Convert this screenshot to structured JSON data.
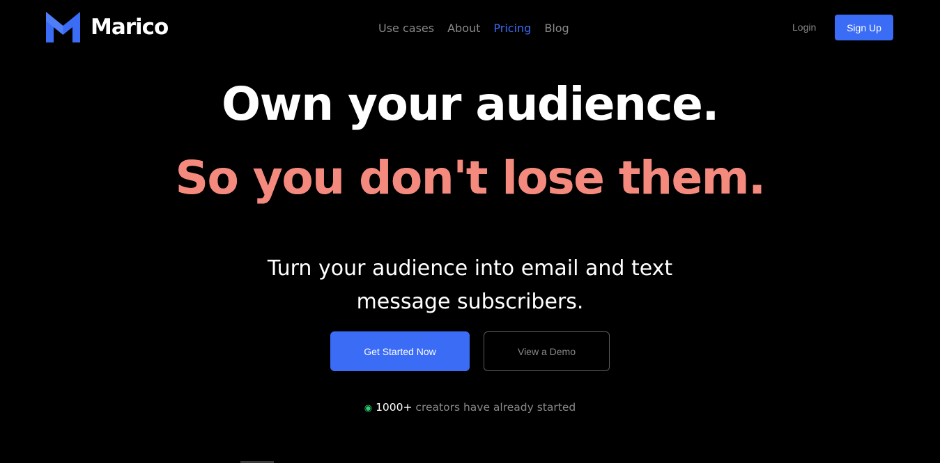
{
  "header": {
    "brand": "Marico",
    "nav": [
      {
        "label": "Use cases",
        "active": false
      },
      {
        "label": "About",
        "active": false
      },
      {
        "label": "Pricing",
        "active": true
      },
      {
        "label": "Blog",
        "active": false
      }
    ],
    "login_label": "Login",
    "signup_label": "Sign Up"
  },
  "hero": {
    "headline_1": "Own your audience.",
    "headline_2": "So you don't lose them.",
    "subtitle_line_1": "Turn your audience into email and text",
    "subtitle_line_2": "message subscribers.",
    "primary_cta": "Get Started Now",
    "secondary_cta": "View a Demo",
    "social_proof_dot": "◉",
    "social_proof_count": "1000+",
    "social_proof_text": " creators have already started"
  },
  "icons": {
    "logo": "marico-logo-icon",
    "status": "green-dot-icon"
  },
  "colors": {
    "background": "#000000",
    "accent": "#3b6cf6",
    "headline_gradient": "#f48a7e",
    "muted_text": "#8a8a8a",
    "status_green": "#2ecc71"
  }
}
